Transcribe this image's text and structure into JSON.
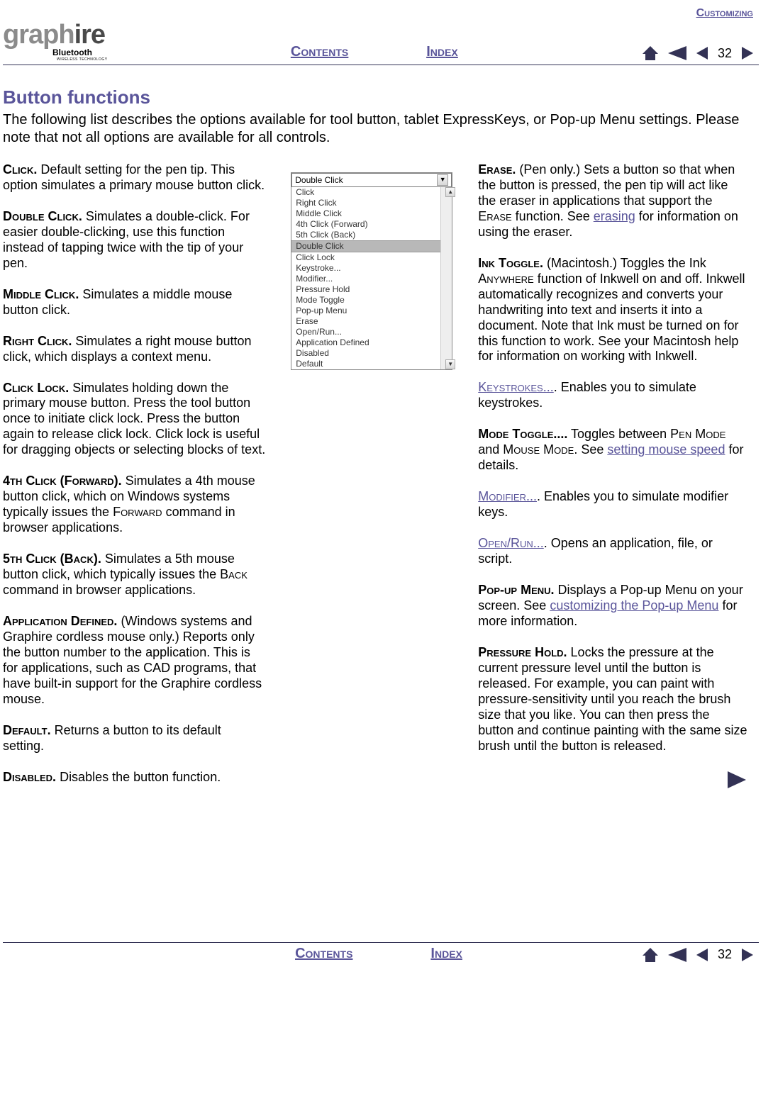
{
  "header": {
    "section": "Customizing",
    "logo_main_a": "graph",
    "logo_main_b": "ire",
    "logo_sub": "Bluetooth",
    "logo_subsub": "WIRELESS TECHNOLOGY",
    "nav_contents": "Contents",
    "nav_index": "Index",
    "page_number": "32"
  },
  "title": "Button functions",
  "intro": "The following list describes the options available for tool button, tablet ExpressKeys, or Pop-up Menu settings.  Please note that not all options are available for all controls.",
  "dropdown": {
    "selected": "Double Click",
    "items": [
      "Click",
      "Right Click",
      "Middle Click",
      "4th Click (Forward)",
      "5th Click (Back)",
      "Double Click",
      "Click Lock",
      "Keystroke...",
      "Modifier...",
      "Pressure Hold",
      "Mode Toggle",
      "Pop-up Menu",
      "Erase",
      "Open/Run...",
      "Application Defined",
      "Disabled",
      "Default"
    ],
    "highlighted": "Double Click"
  },
  "left": {
    "click": {
      "label": "Click.",
      "body": "  Default setting for the pen tip.  This option simulates a primary mouse button click."
    },
    "double_click": {
      "label": "Double Click.",
      "body": "  Simulates a double-click.  For easier double-clicking, use this function instead of tapping twice with the tip of your pen."
    },
    "middle_click": {
      "label": "Middle Click.",
      "body": "  Simulates a middle mouse button click."
    },
    "right_click": {
      "label": "Right Click.",
      "body": "  Simulates a right mouse button click, which displays a context menu."
    },
    "click_lock": {
      "label": "Click Lock.",
      "body": "  Simulates holding down the primary mouse button.  Press the tool button once to initiate click lock.  Press the button again to release click lock.  Click lock is useful for dragging objects or selecting blocks of text."
    },
    "fourth_click": {
      "label": "4th Click (Forward).",
      "body_a": "  Simulates a 4th mouse button click, which on Windows systems typically issues the ",
      "sc": "Forward",
      "body_b": " command in browser applications."
    },
    "fifth_click": {
      "label": "5th Click (Back).",
      "body_a": "  Simulates a 5th mouse button click, which typically issues the ",
      "sc": "Back",
      "body_b": " command in browser applications."
    },
    "app_defined": {
      "label": "Application Defined.",
      "body": "  (Windows systems and Graphire cordless mouse only.)  Reports only the button number to the application.  This is for applications, such as CAD programs, that have built-in support for the Graphire cordless mouse."
    },
    "default": {
      "label": "Default.",
      "body": "  Returns a button to its default setting."
    },
    "disabled": {
      "label": "Disabled.",
      "body": "  Disables the button function."
    }
  },
  "right": {
    "erase": {
      "label": "Erase.",
      "body_a": "  (Pen only.)  Sets a button so that when the button is pressed, the pen tip will act like the eraser in applications that support the ",
      "sc": "Erase",
      "body_b": " function.  See ",
      "link": "erasing",
      "body_c": " for information on using the eraser."
    },
    "ink_toggle": {
      "label": "Ink Toggle.",
      "body_a": "  (Macintosh.)  Toggles the Ink ",
      "sc": "Anywhere",
      "body_b": " function of Inkwell on and off.  Inkwell automatically recognizes and converts your handwriting into text and inserts it into a document.  Note that Ink must be turned on for this function to work.  See your Macintosh help for information on working with Inkwell."
    },
    "keystrokes": {
      "link": "Keystrokes...",
      "body": ".  Enables you to simulate keystrokes."
    },
    "mode_toggle": {
      "label": "Mode Toggle....",
      "body_a": "  Toggles between ",
      "sc1": "Pen Mode",
      "mid": " and ",
      "sc2": "Mouse Mode",
      "body_b": ".  See ",
      "link": "setting mouse speed",
      "body_c": " for details."
    },
    "modifier": {
      "link": "Modifier...",
      "body": ".  Enables you to simulate modifier keys."
    },
    "open_run": {
      "link": "Open/Run...",
      "body": ".  Opens an application, file, or script."
    },
    "popup": {
      "label": "Pop-up Menu.",
      "body_a": "  Displays a Pop-up Menu on your screen.  See ",
      "link": "customizing the Pop-up Menu",
      "body_b": " for more information."
    },
    "pressure_hold": {
      "label": "Pressure Hold.",
      "body": "  Locks the pressure at the current pressure level until the button is released.  For example, you can paint with pressure-sensitivity until you reach the brush size that you like.  You can then press the button and continue painting with the same size brush until the button is released."
    }
  }
}
